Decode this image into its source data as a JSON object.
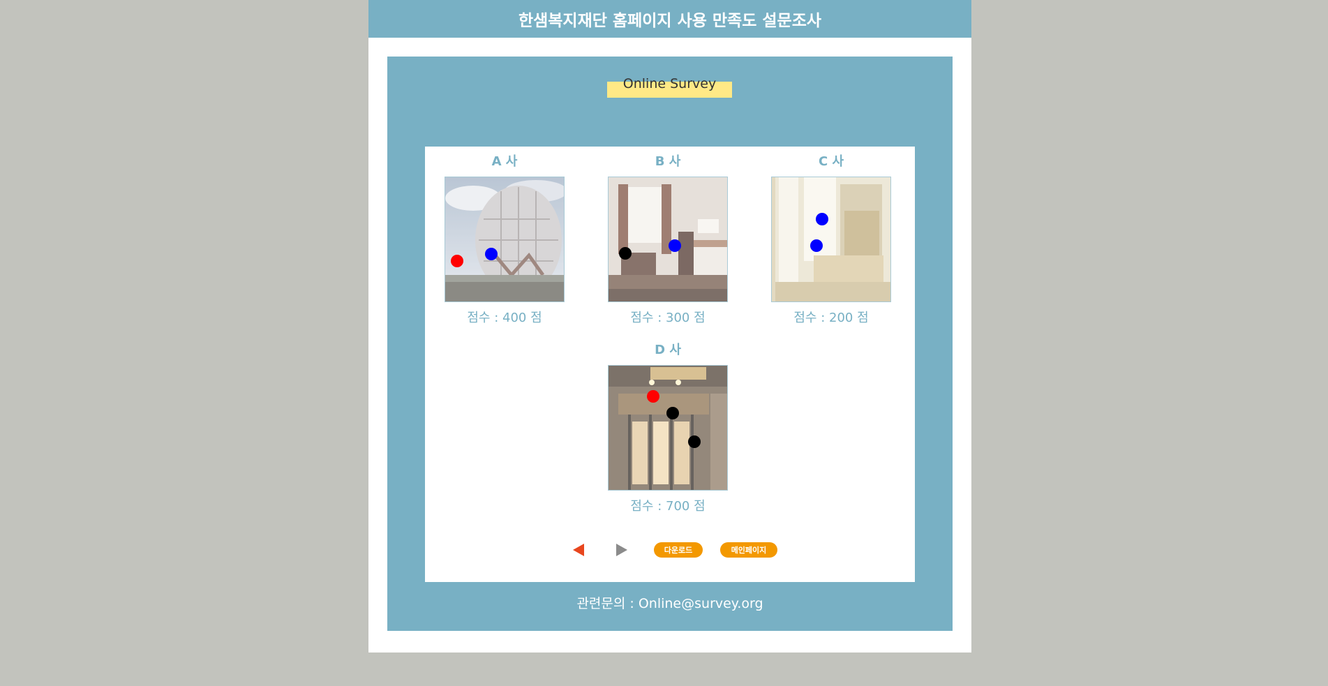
{
  "header": {
    "title": "한샘복지재단 홈페이지 사용 만족도 설문조사"
  },
  "survey_badge": {
    "label": "Online Survey"
  },
  "colors": {
    "accent": "#78b0c4",
    "badge": "#ffe986",
    "button": "#f39800",
    "prev_arrow": "#e8461e",
    "next_arrow": "#8b8b8b",
    "marker_red": "#ff0000",
    "marker_blue": "#0000ff",
    "marker_black": "#000000"
  },
  "companies": [
    {
      "title": "A 사",
      "score_label": "점수 : 400 점",
      "photo": "geodesic-dome-ruins",
      "markers": [
        {
          "color": "red"
        },
        {
          "color": "blue"
        }
      ]
    },
    {
      "title": "B 사",
      "score_label": "점수 : 300 점",
      "photo": "hotel-room",
      "markers": [
        {
          "color": "black"
        },
        {
          "color": "blue"
        }
      ]
    },
    {
      "title": "C 사",
      "score_label": "점수 : 200 점",
      "photo": "ornate-bedroom",
      "markers": [
        {
          "color": "blue"
        },
        {
          "color": "blue"
        }
      ]
    },
    {
      "title": "D 사",
      "score_label": "점수 : 700 점",
      "photo": "storefront-entrance",
      "markers": [
        {
          "color": "red"
        },
        {
          "color": "black"
        },
        {
          "color": "black"
        }
      ]
    }
  ],
  "controls": {
    "prev_icon": "triangle-left-icon",
    "next_icon": "triangle-right-icon",
    "download_label": "다운로드",
    "main_page_label": "메인페이지"
  },
  "footer": {
    "contact": "관련문의 : Online@survey.org"
  }
}
